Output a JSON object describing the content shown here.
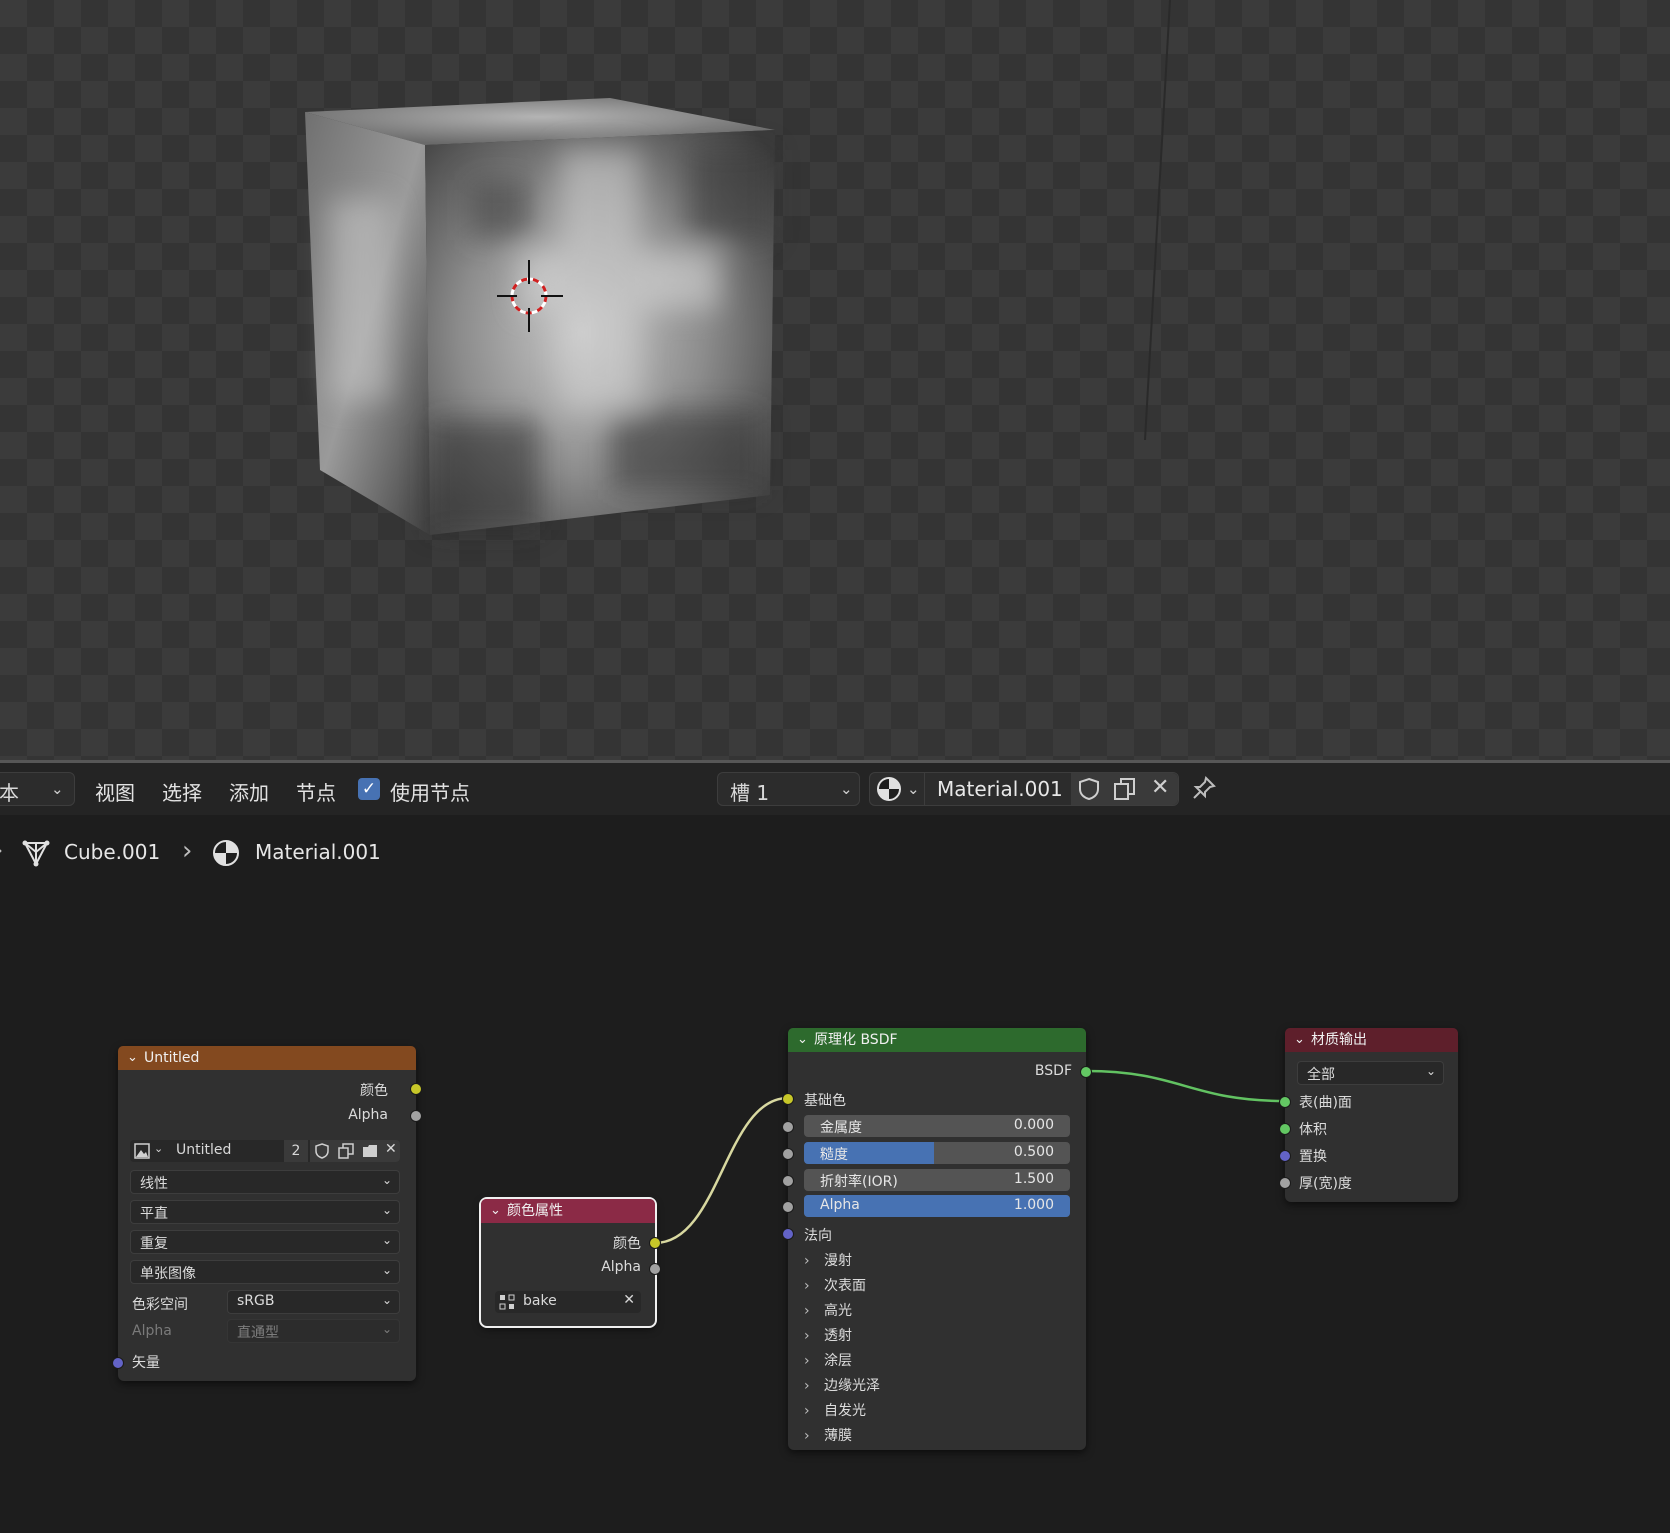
{
  "header": {
    "mode_label": "本",
    "menu": [
      "视图",
      "选择",
      "添加",
      "节点"
    ],
    "use_nodes_label": "使用节点",
    "slot_label": "槽 1",
    "material_name": "Material.001"
  },
  "breadcrumb": {
    "object": "Cube.001",
    "material": "Material.001"
  },
  "image_node": {
    "title": "Untitled",
    "outputs": [
      "颜色",
      "Alpha"
    ],
    "image_name": "Untitled",
    "users": "2",
    "interpolation": "线性",
    "projection": "平直",
    "extension": "重复",
    "source": "单张图像",
    "colorspace_label": "色彩空间",
    "colorspace_value": "sRGB",
    "alpha_label": "Alpha",
    "alpha_value": "直通型",
    "input_vector": "矢量"
  },
  "attr_node": {
    "title": "颜色属性",
    "outputs": [
      "颜色",
      "Alpha"
    ],
    "attribute_name": "bake"
  },
  "bsdf_node": {
    "title": "原理化 BSDF",
    "output": "BSDF",
    "base_color": "基础色",
    "fields": [
      {
        "label": "金属度",
        "value": "0.000",
        "fill": 0.0
      },
      {
        "label": "糙度",
        "value": "0.500",
        "fill": 0.5
      },
      {
        "label": "折射率(IOR)",
        "value": "1.500",
        "fill": 0.0
      },
      {
        "label": "Alpha",
        "value": "1.000",
        "fill": 1.0
      }
    ],
    "normal": "法向",
    "panels": [
      "漫射",
      "次表面",
      "高光",
      "透射",
      "涂层",
      "边缘光泽",
      "自发光",
      "薄膜"
    ]
  },
  "output_node": {
    "title": "材质输出",
    "target": "全部",
    "inputs": [
      "表(曲)面",
      "体积",
      "置换",
      "厚(宽)度"
    ]
  },
  "colors": {
    "image_header": "#83491f",
    "attr_header": "#8b2a46",
    "bsdf_header": "#2d6a2d",
    "output_header": "#5e1f2b",
    "accent": "#4772b3"
  }
}
